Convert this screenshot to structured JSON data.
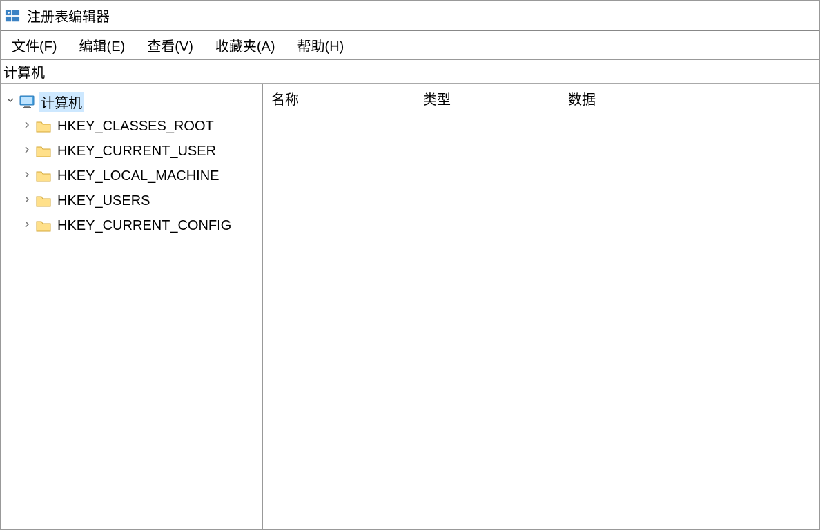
{
  "titlebar": {
    "title": "注册表编辑器"
  },
  "menubar": {
    "items": [
      {
        "label": "文件(F)"
      },
      {
        "label": "编辑(E)"
      },
      {
        "label": "查看(V)"
      },
      {
        "label": "收藏夹(A)"
      },
      {
        "label": "帮助(H)"
      }
    ]
  },
  "pathbar": {
    "path": "计算机"
  },
  "tree": {
    "root_label": "计算机",
    "items": [
      {
        "label": "HKEY_CLASSES_ROOT"
      },
      {
        "label": "HKEY_CURRENT_USER"
      },
      {
        "label": "HKEY_LOCAL_MACHINE"
      },
      {
        "label": "HKEY_USERS"
      },
      {
        "label": "HKEY_CURRENT_CONFIG"
      }
    ]
  },
  "list": {
    "columns": {
      "name": "名称",
      "type": "类型",
      "data": "数据"
    }
  }
}
